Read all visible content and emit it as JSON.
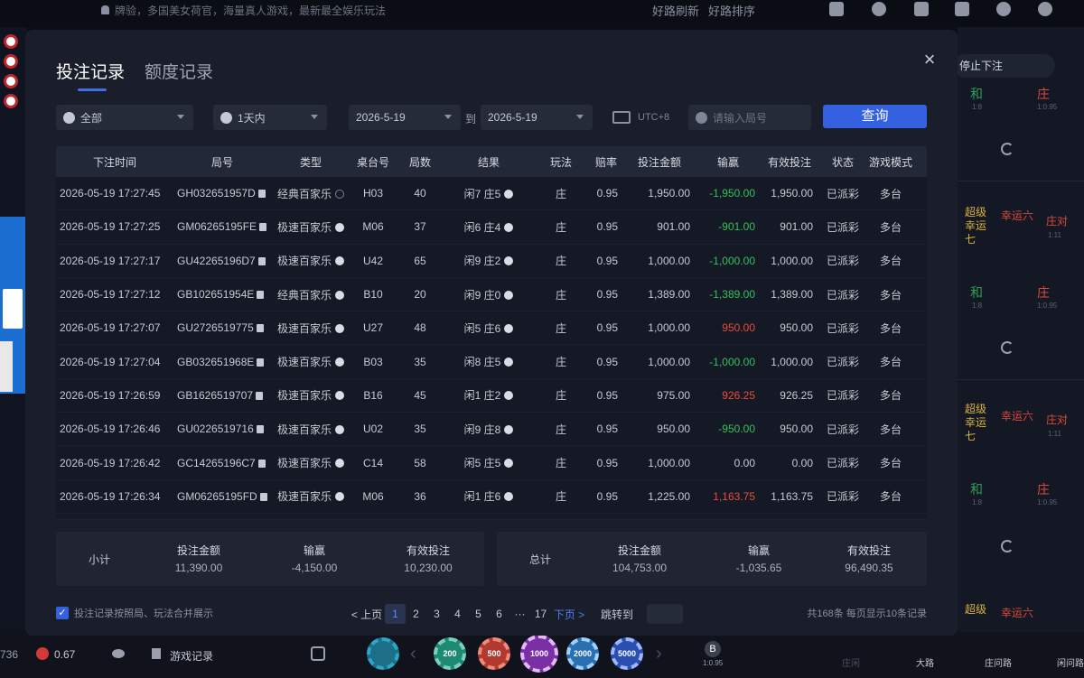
{
  "background": {
    "marquee": "牌验，多国美女荷官，海量真人游戏，最新最全娱乐玩法",
    "top_links": [
      "好路刷新",
      "好路排序"
    ],
    "right_panel": {
      "stop_bet": "停止下注",
      "labels": [
        "和",
        "庄",
        "超级幸运七",
        "幸运六",
        "庄对",
        "和",
        "庄",
        "超级幸运七",
        "幸运六",
        "庄对",
        "和",
        "庄",
        "超级",
        "幸运六"
      ],
      "odds": [
        "1:8",
        "1:0.95",
        "1:11",
        "1:8",
        "1:0.95",
        "1:11",
        "1:8",
        "1:0.95"
      ]
    },
    "bottom": {
      "left_num": "736",
      "balance": "0.67",
      "game_record": "游戏记录",
      "chips": [
        "200",
        "500",
        "1000",
        "2000",
        "5000"
      ],
      "b_odds": "1:0.95",
      "road_labels": [
        "庄闲",
        "大路",
        "庄问路",
        "闲问路"
      ]
    }
  },
  "dialog": {
    "tabs": [
      "投注记录",
      "额度记录"
    ],
    "close": "×",
    "filters": {
      "game": "全部",
      "period": "1天内",
      "date_from": "2026-5-19",
      "to": "到",
      "date_to": "2026-5-19",
      "timezone": "UTC+8",
      "round_placeholder": "请输入局号",
      "query": "查询"
    },
    "columns": [
      "下注时间",
      "局号",
      "类型",
      "桌台号",
      "局数",
      "结果",
      "玩法",
      "赔率",
      "投注金额",
      "输赢",
      "有效投注",
      "状态",
      "游戏模式"
    ],
    "rows": [
      {
        "time": "2026-05-19 17:27:45",
        "id": "GH032651957D",
        "type": "经典百家乐",
        "table": "H03",
        "round": "40",
        "result": "闲7 庄5",
        "play": "庄",
        "odds": "0.95",
        "amount": "1,950.00",
        "win": "-1,950.00",
        "valid": "1,950.00",
        "status": "已派彩",
        "mode": "多台",
        "win_sign": "neg"
      },
      {
        "time": "2026-05-19 17:27:25",
        "id": "GM06265195FE",
        "type": "极速百家乐",
        "table": "M06",
        "round": "37",
        "result": "闲6 庄4",
        "play": "庄",
        "odds": "0.95",
        "amount": "901.00",
        "win": "-901.00",
        "valid": "901.00",
        "status": "已派彩",
        "mode": "多台",
        "win_sign": "neg"
      },
      {
        "time": "2026-05-19 17:27:17",
        "id": "GU42265196D7",
        "type": "极速百家乐",
        "table": "U42",
        "round": "65",
        "result": "闲9 庄2",
        "play": "庄",
        "odds": "0.95",
        "amount": "1,000.00",
        "win": "-1,000.00",
        "valid": "1,000.00",
        "status": "已派彩",
        "mode": "多台",
        "win_sign": "neg"
      },
      {
        "time": "2026-05-19 17:27:12",
        "id": "GB102651954E",
        "type": "经典百家乐",
        "table": "B10",
        "round": "20",
        "result": "闲9 庄0",
        "play": "庄",
        "odds": "0.95",
        "amount": "1,389.00",
        "win": "-1,389.00",
        "valid": "1,389.00",
        "status": "已派彩",
        "mode": "多台",
        "win_sign": "neg"
      },
      {
        "time": "2026-05-19 17:27:07",
        "id": "GU2726519775",
        "type": "极速百家乐",
        "table": "U27",
        "round": "48",
        "result": "闲5 庄6",
        "play": "庄",
        "odds": "0.95",
        "amount": "1,000.00",
        "win": "950.00",
        "valid": "950.00",
        "status": "已派彩",
        "mode": "多台",
        "win_sign": "pos"
      },
      {
        "time": "2026-05-19 17:27:04",
        "id": "GB032651968E",
        "type": "极速百家乐",
        "table": "B03",
        "round": "35",
        "result": "闲8 庄5",
        "play": "庄",
        "odds": "0.95",
        "amount": "1,000.00",
        "win": "-1,000.00",
        "valid": "1,000.00",
        "status": "已派彩",
        "mode": "多台",
        "win_sign": "neg"
      },
      {
        "time": "2026-05-19 17:26:59",
        "id": "GB1626519707",
        "type": "极速百家乐",
        "table": "B16",
        "round": "45",
        "result": "闲1 庄2",
        "play": "庄",
        "odds": "0.95",
        "amount": "975.00",
        "win": "926.25",
        "valid": "926.25",
        "status": "已派彩",
        "mode": "多台",
        "win_sign": "pos"
      },
      {
        "time": "2026-05-19 17:26:46",
        "id": "GU0226519716",
        "type": "极速百家乐",
        "table": "U02",
        "round": "35",
        "result": "闲9 庄8",
        "play": "庄",
        "odds": "0.95",
        "amount": "950.00",
        "win": "-950.00",
        "valid": "950.00",
        "status": "已派彩",
        "mode": "多台",
        "win_sign": "neg"
      },
      {
        "time": "2026-05-19 17:26:42",
        "id": "GC14265196C7",
        "type": "极速百家乐",
        "table": "C14",
        "round": "58",
        "result": "闲5 庄5",
        "play": "庄",
        "odds": "0.95",
        "amount": "1,000.00",
        "win": "0.00",
        "valid": "0.00",
        "status": "已派彩",
        "mode": "多台",
        "win_sign": "zero"
      },
      {
        "time": "2026-05-19 17:26:34",
        "id": "GM06265195FD",
        "type": "极速百家乐",
        "table": "M06",
        "round": "36",
        "result": "闲1 庄6",
        "play": "庄",
        "odds": "0.95",
        "amount": "1,225.00",
        "win": "1,163.75",
        "valid": "1,163.75",
        "status": "已派彩",
        "mode": "多台",
        "win_sign": "pos"
      }
    ],
    "subtotal": {
      "label": "小计",
      "amount_label": "投注金额",
      "amount": "11,390.00",
      "win_label": "输赢",
      "win": "-4,150.00",
      "valid_label": "有效投注",
      "valid": "10,230.00"
    },
    "total": {
      "label": "总计",
      "amount_label": "投注金额",
      "amount": "104,753.00",
      "win_label": "输赢",
      "win": "-1,035.65",
      "valid_label": "有效投注",
      "valid": "96,490.35"
    },
    "footer": {
      "merge_label": "投注记录按照局、玩法合并展示",
      "prev": "< 上页",
      "pages": [
        "1",
        "2",
        "3",
        "4",
        "5",
        "6",
        "···",
        "17"
      ],
      "next": "下页 >",
      "jump": "跳转到",
      "summary": "共168条  每页显示10条记录"
    }
  },
  "colors": {
    "accent": "#3461e0",
    "loss": "#2fc25b",
    "win": "#e84c3d"
  }
}
